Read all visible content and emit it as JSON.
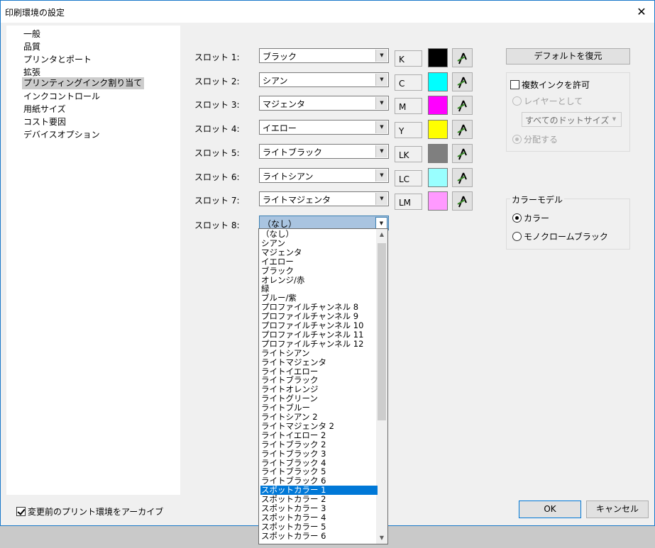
{
  "window": {
    "title": "印刷環境の設定",
    "close_glyph": "✕"
  },
  "nav": {
    "items": [
      {
        "label": "一般",
        "selected": false
      },
      {
        "label": "品質",
        "selected": false
      },
      {
        "label": "プリンタとポート",
        "selected": false
      },
      {
        "label": "拡張",
        "selected": false
      },
      {
        "label": "プリンティングインク割り当て",
        "selected": true
      },
      {
        "label": "インクコントロール",
        "selected": false
      },
      {
        "label": "用紙サイズ",
        "selected": false
      },
      {
        "label": "コスト要因",
        "selected": false
      },
      {
        "label": "デバイスオプション",
        "selected": false
      }
    ]
  },
  "slots": [
    {
      "label": "スロット 1:",
      "ink": "ブラック",
      "code": "K",
      "color": "#000000"
    },
    {
      "label": "スロット 2:",
      "ink": "シアン",
      "code": "C",
      "color": "#00ffff"
    },
    {
      "label": "スロット 3:",
      "ink": "マジェンタ",
      "code": "M",
      "color": "#ff00ff"
    },
    {
      "label": "スロット 4:",
      "ink": "イエロー",
      "code": "Y",
      "color": "#ffff00"
    },
    {
      "label": "スロット 5:",
      "ink": "ライトブラック",
      "code": "LK",
      "color": "#7f7f7f"
    },
    {
      "label": "スロット 6:",
      "ink": "ライトシアン",
      "code": "LC",
      "color": "#99ffff"
    },
    {
      "label": "スロット 7:",
      "ink": "ライトマジェンタ",
      "code": "LM",
      "color": "#ff99ff"
    }
  ],
  "slot8": {
    "label": "スロット 8:",
    "ink": "（なし）"
  },
  "dropdown": {
    "items": [
      "（なし）",
      "シアン",
      "マジェンタ",
      "イエロー",
      "ブラック",
      "オレンジ/赤",
      "緑",
      "ブルー/紫",
      "プロファイルチャンネル 8",
      "プロファイルチャンネル 9",
      "プロファイルチャンネル 10",
      "プロファイルチャンネル 11",
      "プロファイルチャンネル 12",
      "ライトシアン",
      "ライトマジェンタ",
      "ライトイエロー",
      "ライトブラック",
      "ライトオレンジ",
      "ライトグリーン",
      "ライトブルー",
      "ライトシアン 2",
      "ライトマジェンタ 2",
      "ライトイエロー 2",
      "ライトブラック 2",
      "ライトブラック 3",
      "ライトブラック 4",
      "ライトブラック 5",
      "ライトブラック 6",
      "スポットカラー 1",
      "スポットカラー 2",
      "スポットカラー 3",
      "スポットカラー 4",
      "スポットカラー 5",
      "スポットカラー 6"
    ],
    "selected_index": 28
  },
  "right": {
    "restore_default": "デフォルトを復元",
    "multi_ink": {
      "label": "複数インクを許可",
      "checked": false
    },
    "as_layer": "レイヤーとして",
    "dot_size": "すべてのドットサイズ",
    "distribute": "分配する",
    "color_model": {
      "title": "カラーモデル",
      "color": "カラー",
      "mono": "モノクロームブラック",
      "selected": "color"
    }
  },
  "footer": {
    "archive": "変更前のプリント環境をアーカイブ",
    "archive_checked": true,
    "ok": "OK",
    "cancel": "キャンセル"
  },
  "icons": {
    "picker": "eyedropper-icon",
    "arrow": "▼",
    "scroll_up": "▲",
    "scroll_down": "▼"
  }
}
